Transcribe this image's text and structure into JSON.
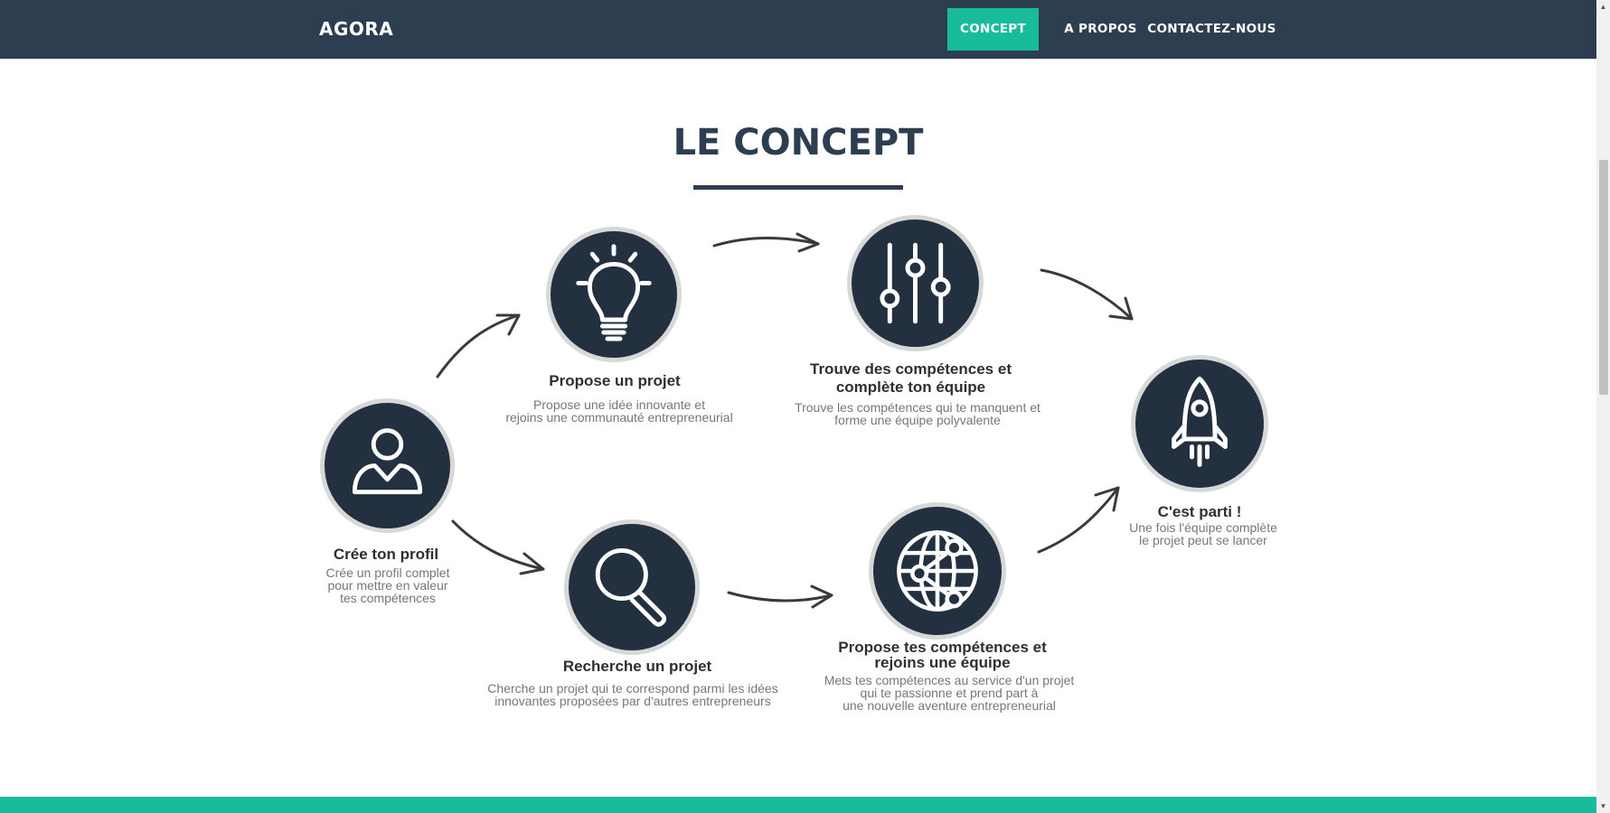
{
  "nav": {
    "brand": "AGORA",
    "items": [
      {
        "label": "CONCEPT",
        "active": true
      },
      {
        "label": "A PROPOS",
        "active": false
      },
      {
        "label": "CONTACTEZ-NOUS",
        "active": false
      }
    ]
  },
  "concept": {
    "title": "LE CONCEPT",
    "steps": [
      {
        "title": "Crée ton profil",
        "desc": "Crée un profil complet\npour mettre en valeur\ntes compétences",
        "icon": "user-icon"
      },
      {
        "title": "Propose un projet",
        "desc": "Propose une idée innovante et\nrejoins une communauté entrepreneurial",
        "icon": "lightbulb-icon"
      },
      {
        "title": "Recherche un projet",
        "desc": "Cherche un projet qui te correspond parmi les idées\ninnovantes proposées par d'autres entrepreneurs",
        "icon": "magnifier-icon"
      },
      {
        "title": "Trouve des compétences et\ncomplète ton équipe",
        "desc": "Trouve les compétences qui te manquent et\nforme une équipe polyvalente",
        "icon": "sliders-icon"
      },
      {
        "title": "Propose tes compétences et\nrejoins une équipe",
        "desc": "Mets tes compétences au service d'un projet\nqui te passionne et prend part à\nune nouvelle aventure entrepreneurial",
        "icon": "globe-network-icon"
      },
      {
        "title": "C'est parti !",
        "desc": "Une fois l'équipe complète\nle projet peut se lancer",
        "icon": "rocket-icon"
      }
    ]
  },
  "colors": {
    "navbar": "#2c3e50",
    "accent": "#18bc9c",
    "circle": "#22303f",
    "circle_border": "#d8d8d8"
  }
}
